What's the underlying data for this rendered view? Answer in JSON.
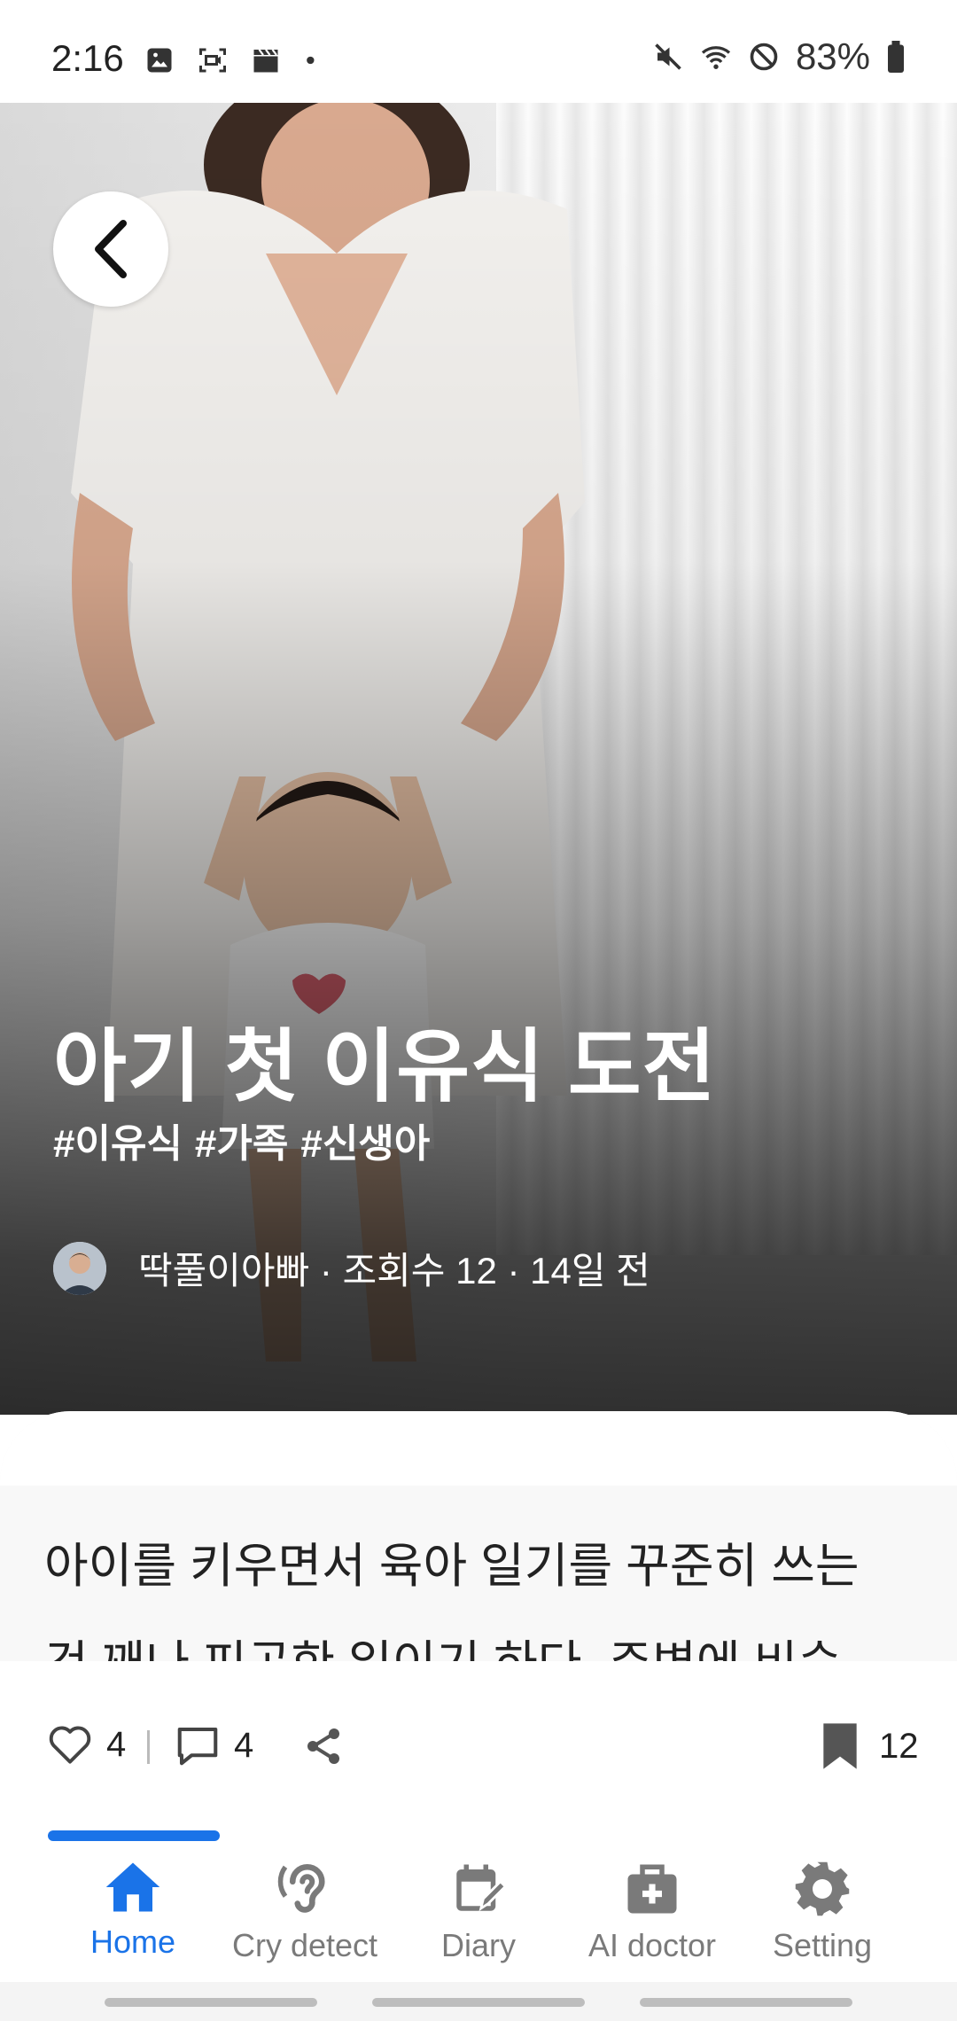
{
  "status_bar": {
    "time": "2:16",
    "battery": "83%",
    "left_icons": [
      "image-icon",
      "screen-record-icon",
      "clapper-icon",
      "dot-icon"
    ],
    "right_icons": [
      "mute-icon",
      "wifi-icon",
      "do-not-disturb-icon",
      "battery-icon"
    ]
  },
  "post": {
    "title": "아기 첫 이유식 도전",
    "tags": [
      "#이유식",
      "#가족",
      "#신생아"
    ],
    "meta": "딱풀이아빠 · 조회수 12 · 14일 전",
    "body_line1": "아이를 키우면서 육아 일기를 꾸준히 쓰는",
    "body_line2": "건 꽤나 피곤한 일이기 하다. 주변에 비슷"
  },
  "actions": {
    "likes": "4",
    "comments": "4",
    "bookmarks": "12"
  },
  "nav": {
    "items": [
      {
        "label": "Home",
        "icon": "home-icon",
        "active": true
      },
      {
        "label": "Cry detect",
        "icon": "ear-icon",
        "active": false
      },
      {
        "label": "Diary",
        "icon": "calendar-edit-icon",
        "active": false
      },
      {
        "label": "AI doctor",
        "icon": "medical-kit-icon",
        "active": false
      },
      {
        "label": "Setting",
        "icon": "gear-icon",
        "active": false
      }
    ]
  },
  "colors": {
    "accent": "#1a73e8",
    "inactive": "#7a7a7a"
  }
}
